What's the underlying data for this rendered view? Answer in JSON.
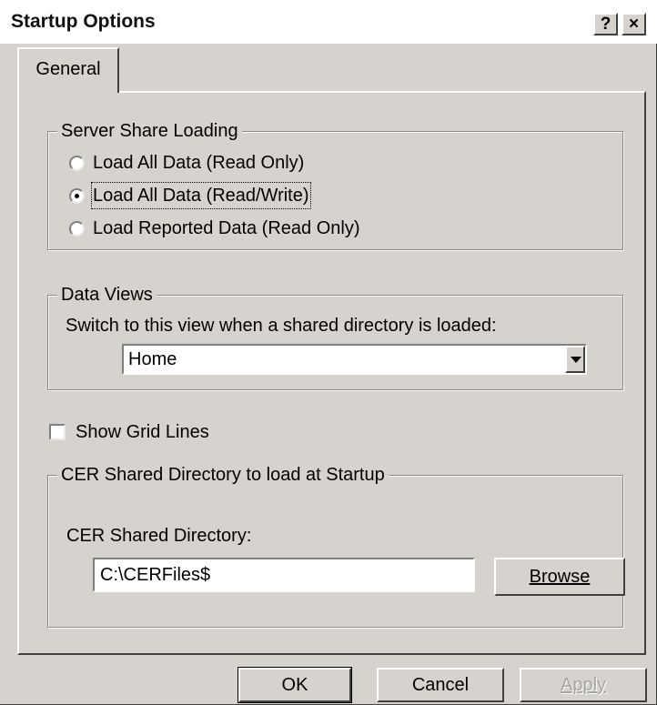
{
  "window": {
    "title": "Startup Options",
    "help_glyph": "?",
    "close_glyph": "×"
  },
  "tabs": [
    {
      "label": "General"
    }
  ],
  "server_share_loading": {
    "legend": "Server Share Loading",
    "options": [
      {
        "label": "Load All Data (Read Only)",
        "checked": false
      },
      {
        "label": "Load All Data (Read/Write)",
        "checked": true
      },
      {
        "label": "Load Reported Data (Read Only)",
        "checked": false
      }
    ]
  },
  "data_views": {
    "legend": "Data Views",
    "prompt": "Switch to this view when a shared directory is loaded:",
    "selected": "Home"
  },
  "show_grid_lines": {
    "label": "Show Grid Lines",
    "checked": false
  },
  "cer_directory": {
    "legend": "CER Shared Directory to load at Startup",
    "field_label": "CER Shared Directory:",
    "value": "C:\\CERFiles$",
    "browse_label": "Browse"
  },
  "buttons": {
    "ok": "OK",
    "cancel": "Cancel",
    "apply": "Apply"
  },
  "colors": {
    "face": "#d6d3ce",
    "shadow": "#404040",
    "highlight": "#ffffff"
  }
}
